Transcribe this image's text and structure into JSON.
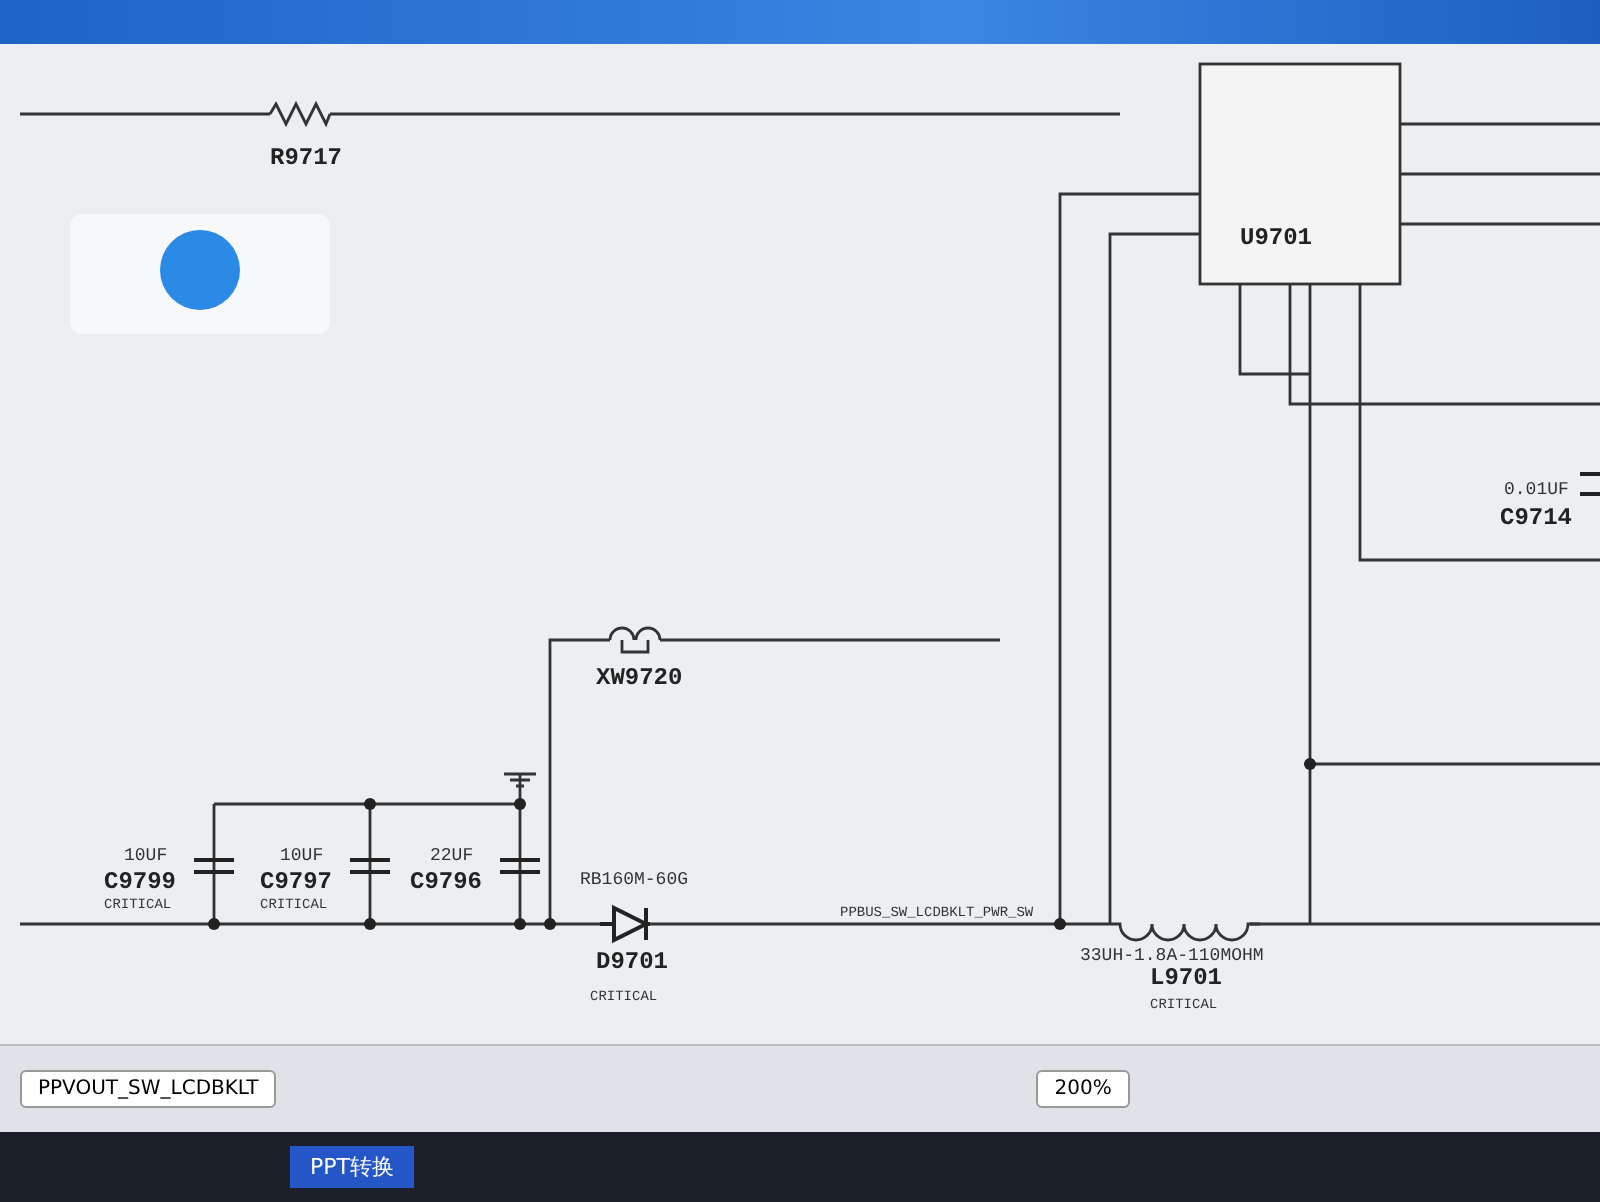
{
  "schematic": {
    "components": [
      {
        "kind": "resistor",
        "ref": "R9717"
      },
      {
        "kind": "ic",
        "ref": "U9701"
      },
      {
        "kind": "jumper",
        "ref": "XW9720"
      },
      {
        "kind": "capacitor",
        "ref": "C9799",
        "value": "10UF",
        "note": "CRITICAL"
      },
      {
        "kind": "capacitor",
        "ref": "C9797",
        "value": "10UF",
        "note": "CRITICAL"
      },
      {
        "kind": "capacitor",
        "ref": "C9796",
        "value": "22UF"
      },
      {
        "kind": "diode",
        "ref": "D9701",
        "value": "RB160M-60G",
        "note": "CRITICAL"
      },
      {
        "kind": "inductor",
        "ref": "L9701",
        "value": "33UH-1.8A-110MOHM",
        "note": "CRITICAL"
      },
      {
        "kind": "capacitor",
        "ref": "C9714",
        "value": "0.01UF"
      }
    ],
    "net_label": "PPBUS_SW_LCDBKLT_PWR_SW"
  },
  "toolbar": {
    "net_field": "PPVOUT_SW_LCDBKLT",
    "zoom": "200%",
    "convert_button": "PPT转换"
  }
}
